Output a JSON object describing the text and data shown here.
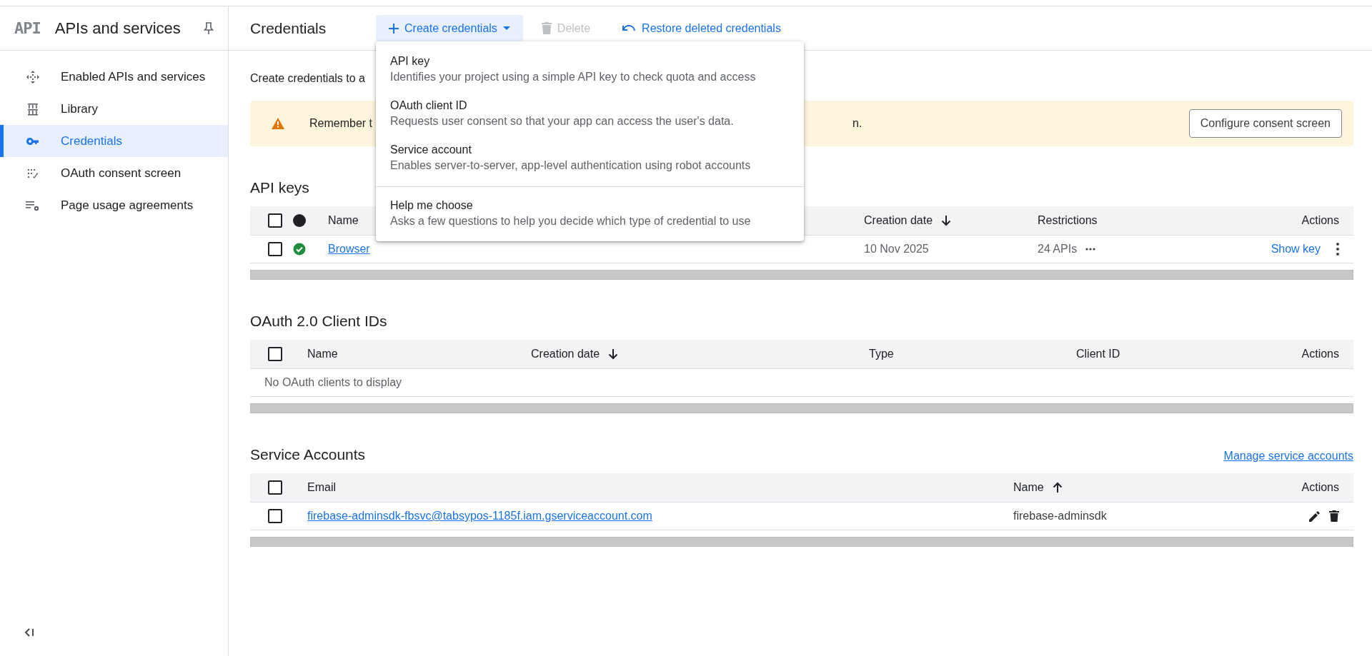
{
  "sidebar": {
    "logo": "API",
    "title": "APIs and services",
    "items": [
      {
        "label": "Enabled APIs and services",
        "selected": false
      },
      {
        "label": "Library",
        "selected": false
      },
      {
        "label": "Credentials",
        "selected": true
      },
      {
        "label": "OAuth consent screen",
        "selected": false
      },
      {
        "label": "Page usage agreements",
        "selected": false
      }
    ]
  },
  "header": {
    "title": "Credentials",
    "actions": [
      {
        "label": "Create credentials",
        "kind": "create",
        "disabled": false
      },
      {
        "label": "Delete",
        "kind": "delete",
        "disabled": true
      },
      {
        "label": "Restore deleted credentials",
        "kind": "restore",
        "disabled": false
      }
    ]
  },
  "intro": "Create credentials to a",
  "banner": {
    "text_start": "Remember t",
    "text_end": "n.",
    "button": "Configure consent screen"
  },
  "api_keys": {
    "title": "API keys",
    "select_all_checked": false,
    "columns": [
      {
        "label": "Name",
        "kind": "plain"
      },
      {
        "label": "Creation date",
        "kind": "sort_down"
      },
      {
        "label": "Restrictions",
        "kind": "plain"
      },
      {
        "label": "Actions",
        "kind": "plain"
      }
    ],
    "rows": [
      {
        "checked": false,
        "status_ok": true,
        "name": "Browser",
        "date": "10 Nov 2025",
        "restrictions": "24 APIs",
        "action": "Show key"
      }
    ]
  },
  "oauth_clients": {
    "title": "OAuth 2.0 Client IDs",
    "select_all_checked": false,
    "columns": [
      {
        "label": "Name",
        "kind": "plain"
      },
      {
        "label": "Creation date",
        "kind": "sort_down"
      },
      {
        "label": "Type",
        "kind": "plain"
      },
      {
        "label": "Client ID",
        "kind": "plain"
      },
      {
        "label": "Actions",
        "kind": "plain"
      }
    ],
    "empty": "No OAuth clients to display"
  },
  "service_accounts": {
    "title": "Service Accounts",
    "link": "Manage service accounts",
    "select_all_checked": false,
    "columns": [
      {
        "label": "Email",
        "kind": "plain"
      },
      {
        "label": "Name",
        "kind": "sort_up"
      },
      {
        "label": "Actions",
        "kind": "plain"
      }
    ],
    "rows": [
      {
        "checked": false,
        "email": "firebase-adminsdk-fbsvc@tabsypos-1185f.iam.gserviceaccount.com",
        "name": "firebase-adminsdk"
      }
    ]
  },
  "menu": {
    "items": [
      {
        "title": "API key",
        "description": "Identifies your project using a simple API key to check quota and access",
        "divider_before": false
      },
      {
        "title": "OAuth client ID",
        "description": "Requests user consent so that your app can access the user's data.",
        "divider_before": false
      },
      {
        "title": "Service account",
        "description": "Enables server-to-server, app-level authentication using robot accounts",
        "divider_before": false
      },
      {
        "title": "Help me choose",
        "description": "Asks a few questions to help you decide which type of credential to use",
        "divider_before": true
      }
    ]
  }
}
